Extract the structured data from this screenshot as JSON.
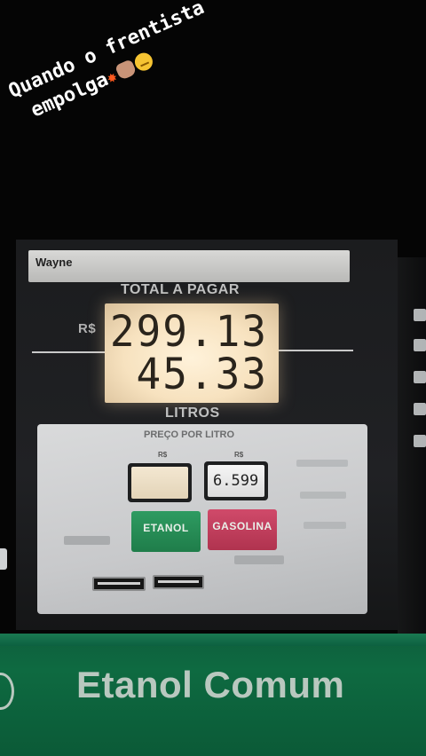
{
  "caption": {
    "line1": "Quando o frentista",
    "line2": "empolga",
    "emojis": [
      "collision-emoji",
      "fist-emoji",
      "unamused-face-emoji"
    ]
  },
  "pump": {
    "brand": "Wayne",
    "total_label": "TOTAL A PAGAR",
    "currency": "R$",
    "total_value": "299.13",
    "liters_value": "45.33",
    "liters_label": "LITROS",
    "price_per_liter_label": "PREÇO POR LITRO",
    "etanol_currency": "R$",
    "gasolina_currency": "R$",
    "gasolina_price": "6.599",
    "etanol_button": "ETANOL",
    "gasolina_button": "GASOLINA"
  },
  "sign": {
    "text": "Etanol Comum"
  },
  "colors": {
    "lcd_backlight": "#f7e2bf",
    "etanol_green": "#1f7d4a",
    "gasolina_red": "#b0334f",
    "sign_green": "#0e6a41"
  }
}
